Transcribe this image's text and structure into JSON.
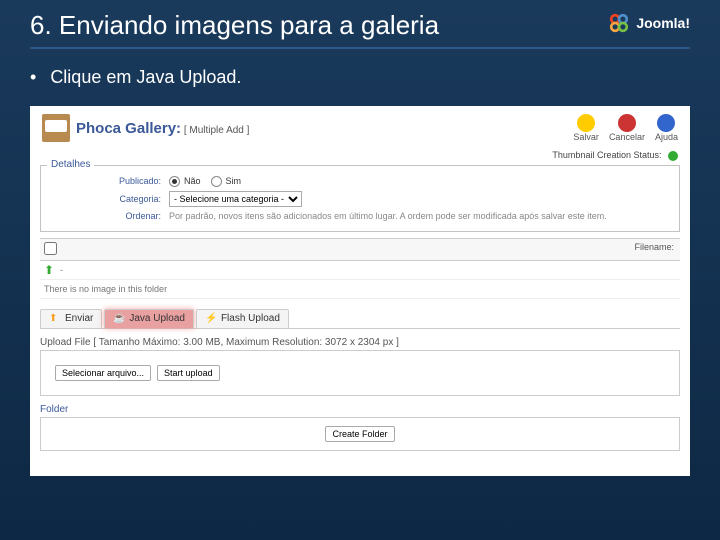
{
  "slide": {
    "title": "6. Enviando imagens para a galeria",
    "bullet": "Clique em Java Upload.",
    "logoText": "Joomla!"
  },
  "app": {
    "title": "Phoca Gallery:",
    "subtitle": "[ Multiple Add ]",
    "toolbar": {
      "save": "Salvar",
      "cancel": "Cancelar",
      "help": "Ajuda"
    },
    "thumbStatus": "Thumbnail Creation Status:"
  },
  "details": {
    "legend": "Detalhes",
    "published": {
      "label": "Publicado:",
      "no": "Não",
      "yes": "Sim"
    },
    "category": {
      "label": "Categoria:",
      "value": "- Selecione uma categoria -"
    },
    "order": {
      "label": "Ordenar:",
      "hint": "Por padrão, novos itens são adicionados em último lugar. A ordem pode ser modificada após salvar este item."
    }
  },
  "list": {
    "chkHeader": "#",
    "filenameHeader": "Filename:",
    "upLabel": "-",
    "emptyText": "There is no image in this folder"
  },
  "tabs": {
    "send": "Enviar",
    "java": "Java Upload",
    "flash": "Flash Upload"
  },
  "upload": {
    "label": "Upload File [ Tamanho Máximo: 3.00 MB, Maximum Resolution: 3072 x 2304 px ]",
    "choose": "Selecionar arquivo...",
    "start": "Start upload"
  },
  "folder": {
    "legend": "Folder",
    "create": "Create Folder"
  }
}
